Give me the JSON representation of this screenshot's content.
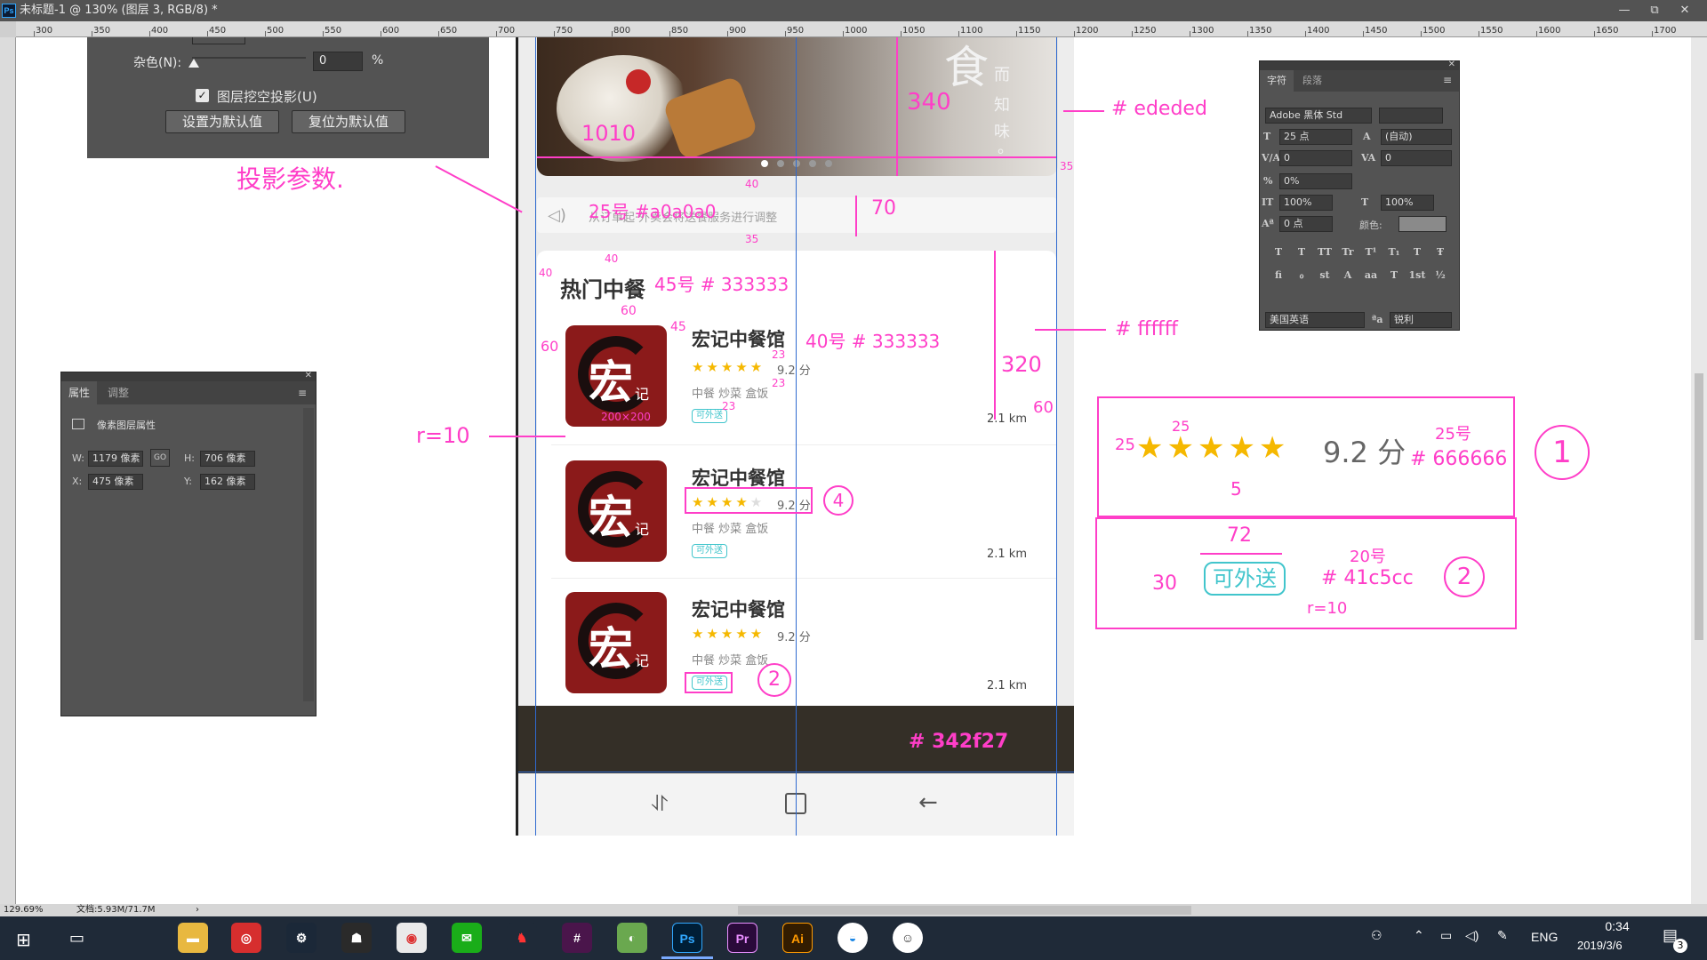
{
  "window": {
    "title": "未标题-1 @ 130% (图层 3, RGB/8) *",
    "app_icon": "Ps",
    "controls": [
      "—",
      "⧉",
      "✕"
    ]
  },
  "ruler": {
    "h_ticks": [
      "300",
      "350",
      "400",
      "450",
      "500",
      "550",
      "600",
      "650",
      "700",
      "750",
      "800",
      "850",
      "900",
      "950",
      "1000",
      "1050",
      "1100",
      "1150",
      "1200",
      "1250",
      "1300",
      "1350",
      "1400",
      "1450",
      "1500",
      "1550",
      "1600",
      "1650",
      "1700"
    ]
  },
  "layer_style_dialog": {
    "noise_label": "杂色(N):",
    "noise_value": "0",
    "noise_unit": "%",
    "knockout_label": "图层挖空投影(U)",
    "knockout_checked": true,
    "set_default_button": "设置为默认值",
    "reset_default_button": "复位为默认值"
  },
  "properties_panel": {
    "tabs": [
      "属性",
      "调整"
    ],
    "layer_type": "像素图层属性",
    "w_label": "W:",
    "w_value": "1179 像素",
    "link_label": "GO",
    "h_label": "H:",
    "h_value": "706 像素",
    "x_label": "X:",
    "x_value": "475 像素",
    "y_label": "Y:",
    "y_value": "162 像素"
  },
  "character_panel": {
    "tabs": [
      "字符",
      "段落"
    ],
    "font_family": "Adobe 黑体 Std",
    "font_size": "25 点",
    "leading": "(自动)",
    "kerning": "0",
    "tracking": "0",
    "scale_pct": "0%",
    "v_scale": "100%",
    "h_scale": "100%",
    "baseline": "0 点",
    "color_label": "颜色:",
    "style_buttons": [
      "T",
      "T",
      "TT",
      "Tr",
      "T¹",
      "T₁",
      "T",
      "Ŧ"
    ],
    "opentype_buttons": [
      "fi",
      "ℴ",
      "st",
      "A",
      "aa",
      "T",
      "1st",
      "½"
    ],
    "language": "美国英语",
    "aa_label": "ªa",
    "antialias": "锐利"
  },
  "app_mock": {
    "banner_chars": [
      "食",
      "而",
      "知",
      "味",
      "。"
    ],
    "notice_text": "从订单起·外卖会将送餐服务进行调整",
    "section_title": "热门中餐",
    "restaurants": [
      {
        "name": "宏记中餐馆",
        "rating": 5,
        "score": "9.2 分",
        "tags": "中餐 炒菜 盒饭",
        "badge": "可外送",
        "distance": "2.1 km",
        "logo_main": "宏",
        "logo_sub": "记"
      },
      {
        "name": "宏记中餐馆",
        "rating": 4,
        "score": "9.2 分",
        "tags": "中餐 炒菜 盒饭",
        "badge": "可外送",
        "distance": "2.1 km",
        "logo_main": "宏",
        "logo_sub": "记"
      },
      {
        "name": "宏记中餐馆",
        "rating": 5,
        "score": "9.2 分",
        "tags": "中餐 炒菜 盒饭",
        "badge": "可外送",
        "distance": "2.1 km",
        "logo_main": "宏",
        "logo_sub": "记"
      }
    ],
    "bottom_bar_color": "#342f27",
    "nav_icons": [
      "recent-apps-icon",
      "home-icon",
      "back-icon"
    ]
  },
  "annotations": {
    "shadow_params": "投影参数.",
    "w1010": "1010",
    "h340": "340",
    "bg_color": "# ededed",
    "n35": "35",
    "n40a": "40",
    "notice_spec": "25号 #a0a0a0",
    "n70": "70",
    "n35b": "35",
    "n40b": "40",
    "n40c": "40",
    "title_spec": "45号 # 333333",
    "n60a": "60",
    "n60b": "60",
    "n45": "45",
    "name_spec": "40号 # 333333",
    "n23a": "23",
    "n23b": "23",
    "n23c": "23",
    "logo_size": "200×200",
    "r10": "r=10",
    "card_color": "# ffffff",
    "n320": "320",
    "n60c": "60",
    "circle4": "4",
    "circle2": "2",
    "bottom_color": "# 342f27",
    "box1": {
      "n25a": "25",
      "n25b": "25",
      "n5": "5",
      "score": "9.2 分",
      "size": "25号",
      "color": "# 666666",
      "circle": "1"
    },
    "box2": {
      "n72": "72",
      "n30": "30",
      "badge": "可外送",
      "size": "20号",
      "color": "# 41c5cc",
      "r": "r=10",
      "circle": "2"
    }
  },
  "status_bar": {
    "zoom": "129.69%",
    "doc": "文档:5.93M/71.7M"
  },
  "taskbar": {
    "apps": [
      "Ps",
      "Pr",
      "Ai"
    ],
    "lang": "ENG",
    "time": "0:34",
    "date": "2019/3/6",
    "notif_count": "3"
  }
}
